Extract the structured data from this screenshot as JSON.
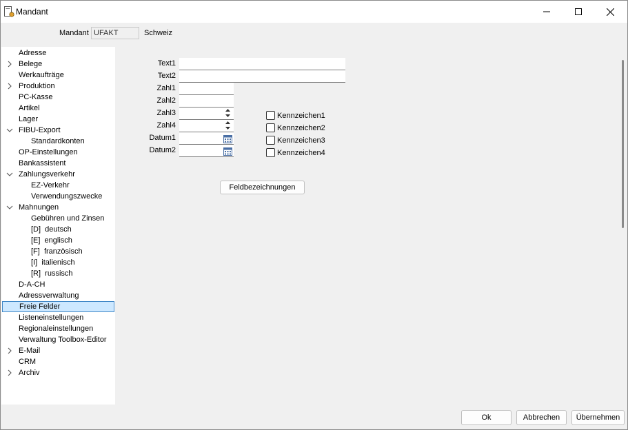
{
  "window": {
    "title": "Mandant"
  },
  "mandant": {
    "label": "Mandant",
    "value": "UFAKT",
    "country": "Schweiz"
  },
  "tree": [
    {
      "label": "Adresse",
      "level": 0,
      "expander": "none"
    },
    {
      "label": "Belege",
      "level": 0,
      "expander": "collapsed"
    },
    {
      "label": "Werkaufträge",
      "level": 0,
      "expander": "none"
    },
    {
      "label": "Produktion",
      "level": 0,
      "expander": "collapsed"
    },
    {
      "label": "PC-Kasse",
      "level": 0,
      "expander": "none"
    },
    {
      "label": "Artikel",
      "level": 0,
      "expander": "none"
    },
    {
      "label": "Lager",
      "level": 0,
      "expander": "none"
    },
    {
      "label": "FIBU-Export",
      "level": 0,
      "expander": "expanded"
    },
    {
      "label": "Standardkonten",
      "level": 1,
      "expander": "none"
    },
    {
      "label": "OP-Einstellungen",
      "level": 0,
      "expander": "none"
    },
    {
      "label": "Bankassistent",
      "level": 0,
      "expander": "none"
    },
    {
      "label": "Zahlungsverkehr",
      "level": 0,
      "expander": "expanded"
    },
    {
      "label": "EZ-Verkehr",
      "level": 1,
      "expander": "none"
    },
    {
      "label": "Verwendungszwecke",
      "level": 1,
      "expander": "none"
    },
    {
      "label": "Mahnungen",
      "level": 0,
      "expander": "expanded"
    },
    {
      "label": "Gebühren und Zinsen",
      "level": 1,
      "expander": "none"
    },
    {
      "label": "[D]  deutsch",
      "level": 1,
      "expander": "none"
    },
    {
      "label": "[E]  englisch",
      "level": 1,
      "expander": "none"
    },
    {
      "label": "[F]  französisch",
      "level": 1,
      "expander": "none"
    },
    {
      "label": "[I]  italienisch",
      "level": 1,
      "expander": "none"
    },
    {
      "label": "[R]  russisch",
      "level": 1,
      "expander": "none"
    },
    {
      "label": "D-A-CH",
      "level": 0,
      "expander": "none"
    },
    {
      "label": "Adressverwaltung",
      "level": 0,
      "expander": "none"
    },
    {
      "label": "Freie Felder",
      "level": 0,
      "expander": "none",
      "selected": true
    },
    {
      "label": "Listeneinstellungen",
      "level": 0,
      "expander": "none"
    },
    {
      "label": "Regionaleinstellungen",
      "level": 0,
      "expander": "none"
    },
    {
      "label": "Verwaltung Toolbox-Editor",
      "level": 0,
      "expander": "none"
    },
    {
      "label": "E-Mail",
      "level": 0,
      "expander": "collapsed"
    },
    {
      "label": "CRM",
      "level": 0,
      "expander": "none"
    },
    {
      "label": "Archiv",
      "level": 0,
      "expander": "collapsed"
    }
  ],
  "fields": {
    "text1": {
      "label": "Text1",
      "value": ""
    },
    "text2": {
      "label": "Text2",
      "value": ""
    },
    "zahl1": {
      "label": "Zahl1",
      "value": ""
    },
    "zahl2": {
      "label": "Zahl2",
      "value": ""
    },
    "zahl3": {
      "label": "Zahl3",
      "value": ""
    },
    "zahl4": {
      "label": "Zahl4",
      "value": ""
    },
    "datum1": {
      "label": "Datum1",
      "value": ""
    },
    "datum2": {
      "label": "Datum2",
      "value": ""
    }
  },
  "flags": [
    {
      "label": "Kennzeichen1",
      "checked": false
    },
    {
      "label": "Kennzeichen2",
      "checked": false
    },
    {
      "label": "Kennzeichen3",
      "checked": false
    },
    {
      "label": "Kennzeichen4",
      "checked": false
    }
  ],
  "buttons": {
    "feldbezeichnungen": "Feldbezeichnungen",
    "ok": "Ok",
    "abbrechen": "Abbrechen",
    "uebernehmen": "Übernehmen"
  },
  "colors": {
    "selection_bg": "#cde8ff",
    "selection_border": "#3d85c6"
  }
}
